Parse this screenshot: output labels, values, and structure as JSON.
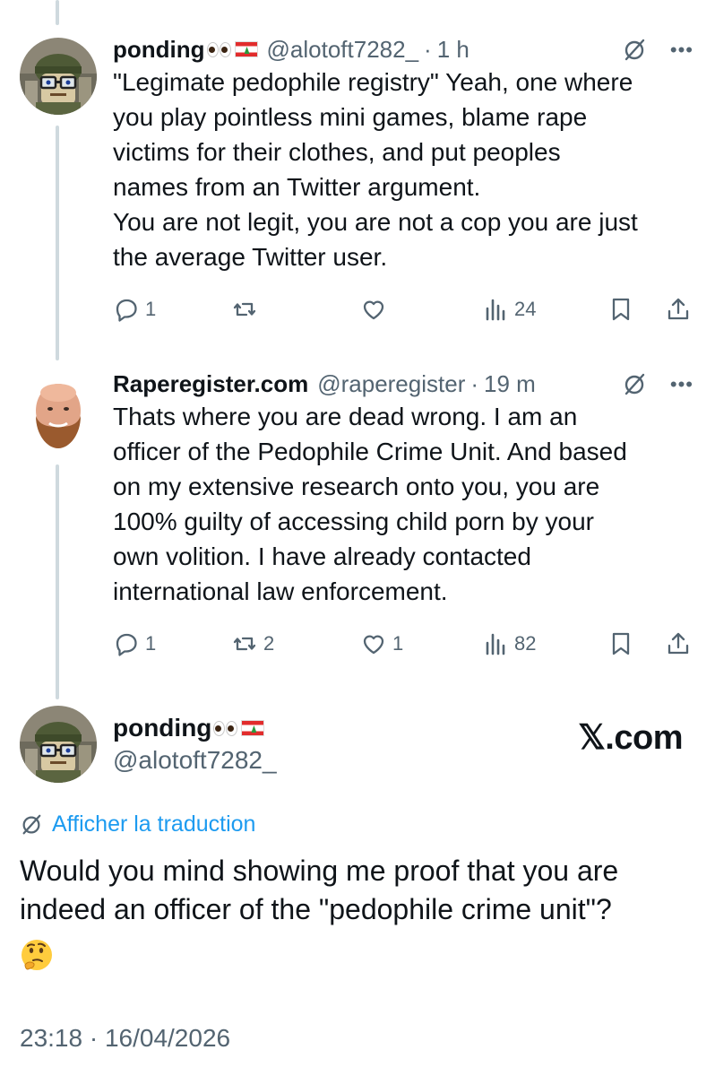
{
  "reply1": {
    "name": "ponding",
    "handle": "@alotoft7282_",
    "time": "1 h",
    "lines": [
      "\"Legimate pedophile registry\" Yeah, one where",
      "you play pointless mini games, blame rape",
      "victims for their clothes, and put peoples",
      "names from an Twitter argument.",
      "You are not legit, you are not a cop you are just",
      "the average Twitter user."
    ],
    "stats": {
      "replies": "1",
      "reposts": "",
      "likes": "",
      "views": "24"
    }
  },
  "reply2": {
    "name": "Raperegister.com",
    "handle": "@raperegister",
    "time": "19 m",
    "lines": [
      "Thats where you are dead wrong. I am an",
      "officer of the Pedophile Crime Unit. And based",
      "on my extensive research onto you, you are",
      "100% guilty of accessing child porn by your",
      "own volition. I have already contacted",
      "international law enforcement."
    ],
    "stats": {
      "replies": "1",
      "reposts": "2",
      "likes": "1",
      "views": "82"
    }
  },
  "main": {
    "name": "ponding",
    "handle": "@alotoft7282_",
    "brand": "𝕏.com",
    "translate_label": "Afficher la traduction",
    "lines": [
      "Would you mind showing me proof that you are",
      "indeed an officer of the \"pedophile crime unit\"?"
    ],
    "emoji": "thinking-face",
    "timestamp": "23:18 · 16/04/2026"
  },
  "icons": [
    "reply-icon",
    "repost-icon",
    "like-icon",
    "views-icon",
    "bookmark-icon",
    "share-icon",
    "grok-icon",
    "more-icon",
    "translate-icon"
  ],
  "colors": {
    "link": "#1d9bf0",
    "secondary": "#536471",
    "text": "#0f1419",
    "thread": "#cfd9de"
  }
}
